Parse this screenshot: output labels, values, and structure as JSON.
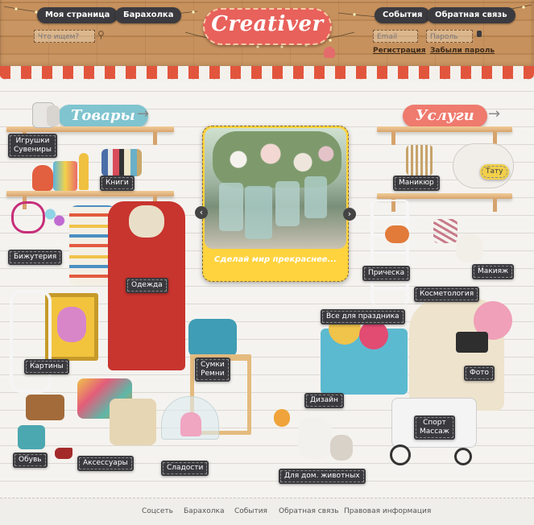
{
  "header": {
    "my_page": "Моя страница",
    "flea_market": "Барахолка",
    "events": "События",
    "feedback": "Обратная связь",
    "search_placeholder": "Что ищем?",
    "email_placeholder": "Email",
    "password_placeholder": "Пароль",
    "register": "Регистрация",
    "forgot_password": "Забыли пароль",
    "logo": "Creativer"
  },
  "sections": {
    "goods": "Товары",
    "services": "Услуги"
  },
  "slider": {
    "caption": "Сделай мир прекраснее..."
  },
  "categories": {
    "toys": "Игрушки\nСувениры",
    "books": "Книги",
    "jewelry": "Бижутерия",
    "clothes": "Одежда",
    "pictures": "Картины",
    "bags": "Сумки\nРемни",
    "shoes": "Обувь",
    "accessories": "Аксессуары",
    "sweets": "Сладости",
    "manicure": "Маникюр",
    "hairstyle": "Прическа",
    "makeup": "Макияж",
    "cosmetology": "Косметология",
    "party": "Все для праздника",
    "photo": "Фото",
    "design": "Дизайн",
    "sport": "Спорт\nМассаж",
    "pets": "Для дом. животных",
    "tattoo": "Тату"
  },
  "footer": {
    "links": [
      "Соцсеть",
      "Барахолка",
      "События",
      "Обратная связь",
      "Правовая информация"
    ]
  },
  "colors": {
    "goods_sign": "#7fc4cf",
    "services_sign": "#ef7a6e",
    "tag_bg": "#3a3a3e",
    "slider_frame": "#ffd33e"
  }
}
